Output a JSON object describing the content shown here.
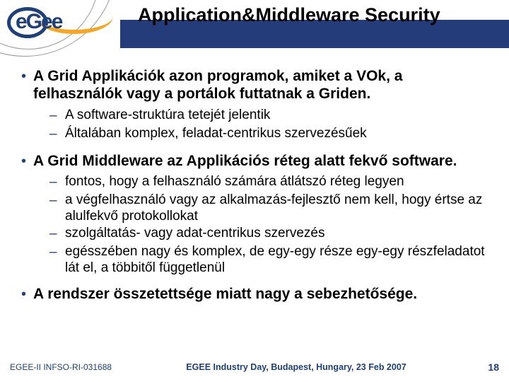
{
  "logo_text": "eGee",
  "header": {
    "title": "Application&Middleware Security"
  },
  "bullets": [
    {
      "text": "A Grid Applikációk azon programok, amiket a VOk, a felhasználók vagy a portálok futtatnak a Griden.",
      "sub": [
        "A software-struktúra tetejét jelentik",
        "Általában komplex, feladat-centrikus szervezésűek"
      ]
    },
    {
      "text": "A Grid Middleware az Applikációs réteg alatt fekvő software.",
      "sub": [
        "fontos, hogy a felhasználó számára átlátszó réteg legyen",
        "a végfelhasználó vagy az alkalmazás-fejlesztő nem kell, hogy értse az alulfekvő protokollokat",
        "szolgáltatás- vagy adat-centrikus szervezés",
        "egésszében nagy és komplex, de egy-egy része egy-egy részfeladatot lát el, a többitől függetlenül"
      ]
    },
    {
      "text": "A rendszer összetettsége miatt nagy a sebezhetősége.",
      "sub": []
    }
  ],
  "footer": {
    "left": "EGEE-II INFSO-RI-031688",
    "mid": "EGEE Industry Day, Budapest, Hungary, 23 Feb 2007",
    "page": "18"
  }
}
